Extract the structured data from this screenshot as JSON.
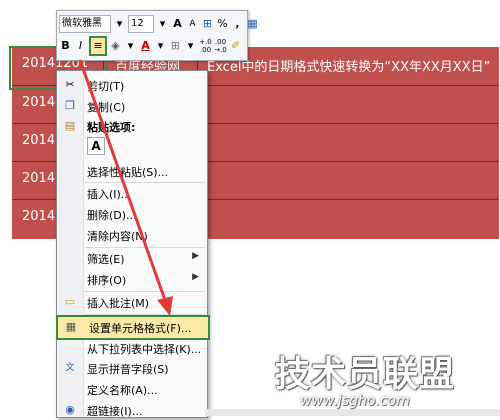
{
  "sheet": {
    "rows": [
      {
        "c1": "20141201",
        "c2": "百度经验网",
        "c3": "Excel中的日期格式快速转换为“XX年XX月XX日”"
      },
      {
        "c1": "2014",
        "c2": "",
        "c3": ""
      },
      {
        "c1": "2014",
        "c2": "",
        "c3": ""
      },
      {
        "c1": "2014",
        "c2": "",
        "c3": ""
      },
      {
        "c1": "2014",
        "c2": "",
        "c3": ""
      }
    ],
    "fill_color": "#c0504d"
  },
  "mini_toolbar": {
    "font_name": "微软雅黑",
    "font_size": "12",
    "grow_font": "A",
    "shrink_font": "A",
    "percent": "%",
    "comma": ",",
    "bold": "B",
    "italic": "I",
    "font_color_label": "A",
    "decimal_increase": "+.0\n.00",
    "decimal_decrease": ".00\n→.0"
  },
  "context_menu": {
    "items": [
      {
        "label": "剪切(T)",
        "icon": "scissors-icon"
      },
      {
        "label": "复制(C)",
        "icon": "copy-icon"
      },
      {
        "label": "粘贴选项:",
        "icon": "paste-icon"
      },
      {
        "label": "A",
        "icon": "paste-values-icon"
      },
      {
        "label": "选择性粘贴(S)...",
        "icon": ""
      },
      {
        "label": "插入(I)...",
        "icon": ""
      },
      {
        "label": "删除(D)...",
        "icon": ""
      },
      {
        "label": "清除内容(N)",
        "icon": ""
      },
      {
        "label": "筛选(E)",
        "icon": ""
      },
      {
        "label": "排序(O)",
        "icon": ""
      },
      {
        "label": "插入批注(M)",
        "icon": "comment-icon"
      },
      {
        "label": "设置单元格格式(F)...",
        "icon": "format-cells-icon"
      },
      {
        "label": "从下拉列表中选择(K)...",
        "icon": ""
      },
      {
        "label": "显示拼音字段(S)",
        "icon": "phonetic-icon"
      },
      {
        "label": "定义名称(A)...",
        "icon": ""
      },
      {
        "label": "超链接(I)...",
        "icon": "hyperlink-icon"
      }
    ]
  },
  "watermark": {
    "title": "技术员联盟",
    "url": "www.jsgho.com"
  },
  "colors": {
    "highlight": "#fde9a6",
    "annotation_green": "#3a8a3a",
    "arrow_red": "#e03a3a"
  }
}
